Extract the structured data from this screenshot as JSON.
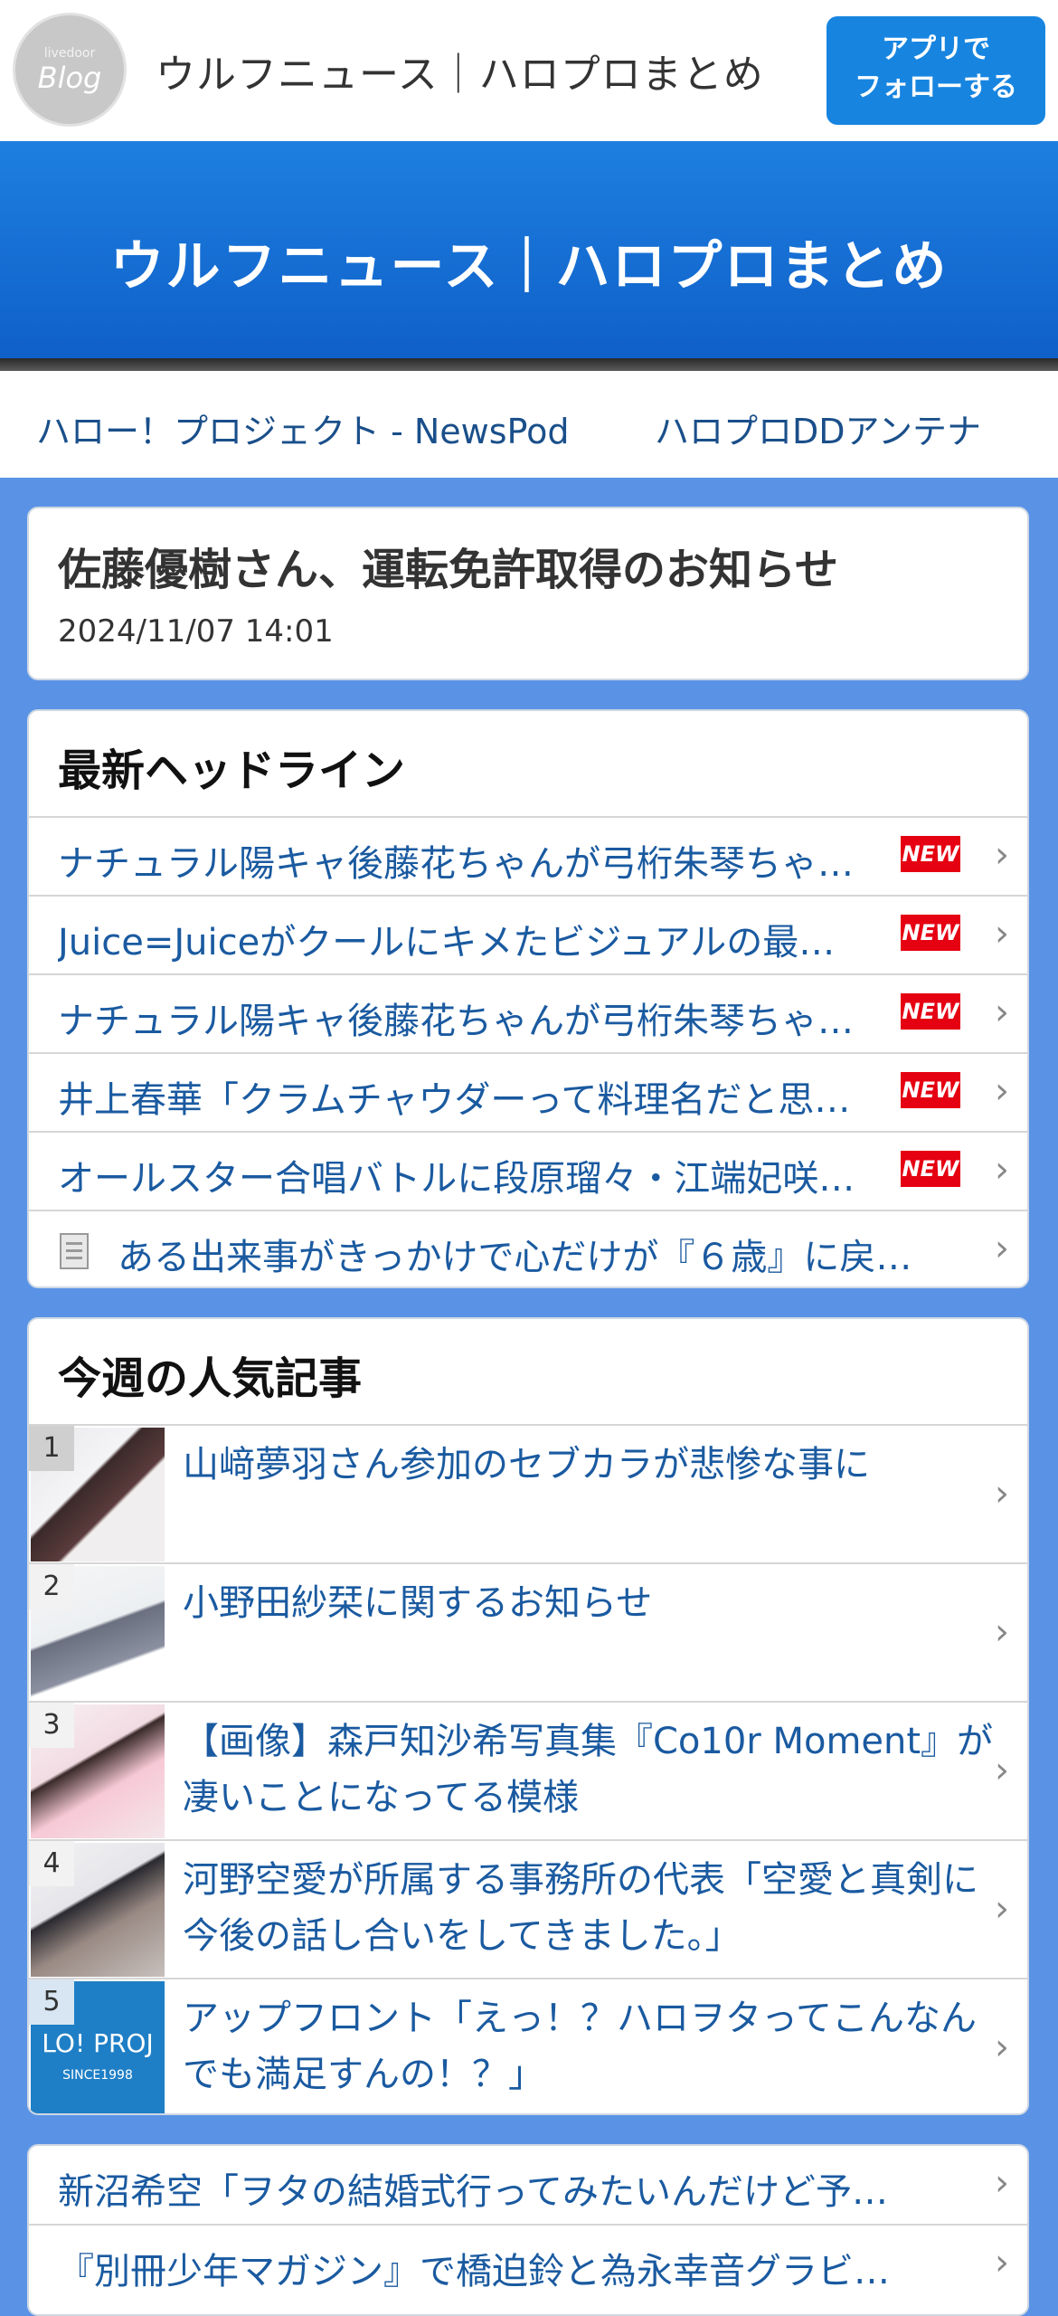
{
  "header": {
    "logo_small": "livedoor",
    "logo_big": "Blog",
    "site_title": "ウルフニュース｜ハロプロまとめ",
    "follow_button": [
      "アプリで",
      "フォローする"
    ]
  },
  "hero": {
    "title": "ウルフニュース｜ハロプロまとめ"
  },
  "links": [
    "ハロー！プロジェクト - NewsPod",
    "ハロプロDDアンテナ"
  ],
  "article": {
    "title": "佐藤優樹さん、運転免許取得のお知らせ",
    "date": "2024/11/07 14:01"
  },
  "headlines": {
    "title": "最新ヘッドライン",
    "items": [
      {
        "text": "ナチュラル陽キャ後藤花ちゃんが弓桁朱琴ちゃ…",
        "badge": "NEW"
      },
      {
        "text": "Juice=Juiceがクールにキメたビジュアルの最…",
        "badge": "NEW"
      },
      {
        "text": "ナチュラル陽キャ後藤花ちゃんが弓桁朱琴ちゃ…",
        "badge": "NEW"
      },
      {
        "text": "井上春華「クラムチャウダーって料理名だと思…",
        "badge": "NEW"
      },
      {
        "text": "オールスター合唱バトルに段原瑠々・江端妃咲…",
        "badge": "NEW"
      },
      {
        "text": "ある出来事がきっかけで心だけが『６歳』に戻…",
        "icon": "document-icon"
      }
    ]
  },
  "popular": {
    "title": "今週の人気記事",
    "items": [
      {
        "rank": "1",
        "text": "山﨑夢羽さん参加のセブカラが悲惨な事に"
      },
      {
        "rank": "2",
        "text": "小野田紗栞に関するお知らせ"
      },
      {
        "rank": "3",
        "text": "【画像】森戸知沙希写真集『Co10r Moment』が凄いことになってる模様"
      },
      {
        "rank": "4",
        "text": "河野空愛が所属する事務所の代表「空愛と真剣に今後の話し合いをしてきました。」"
      },
      {
        "rank": "5",
        "text": "アップフロント「えっ！？ハロヲタってこんなんでも満足すんの！？」",
        "thumb_text": [
          "LO! PROJ",
          "SINCE1998"
        ]
      }
    ]
  },
  "more": {
    "items": [
      "新沼希空「ヲタの結婚式行ってみたいんだけど予…",
      "『別冊少年マガジン』で橋迫鈴と為永幸音グラビ…"
    ]
  },
  "colors": {
    "accent": "#1785e0",
    "page_bg": "#5a93e6",
    "new_badge": "#e50012",
    "link": "#1a5aa0"
  }
}
